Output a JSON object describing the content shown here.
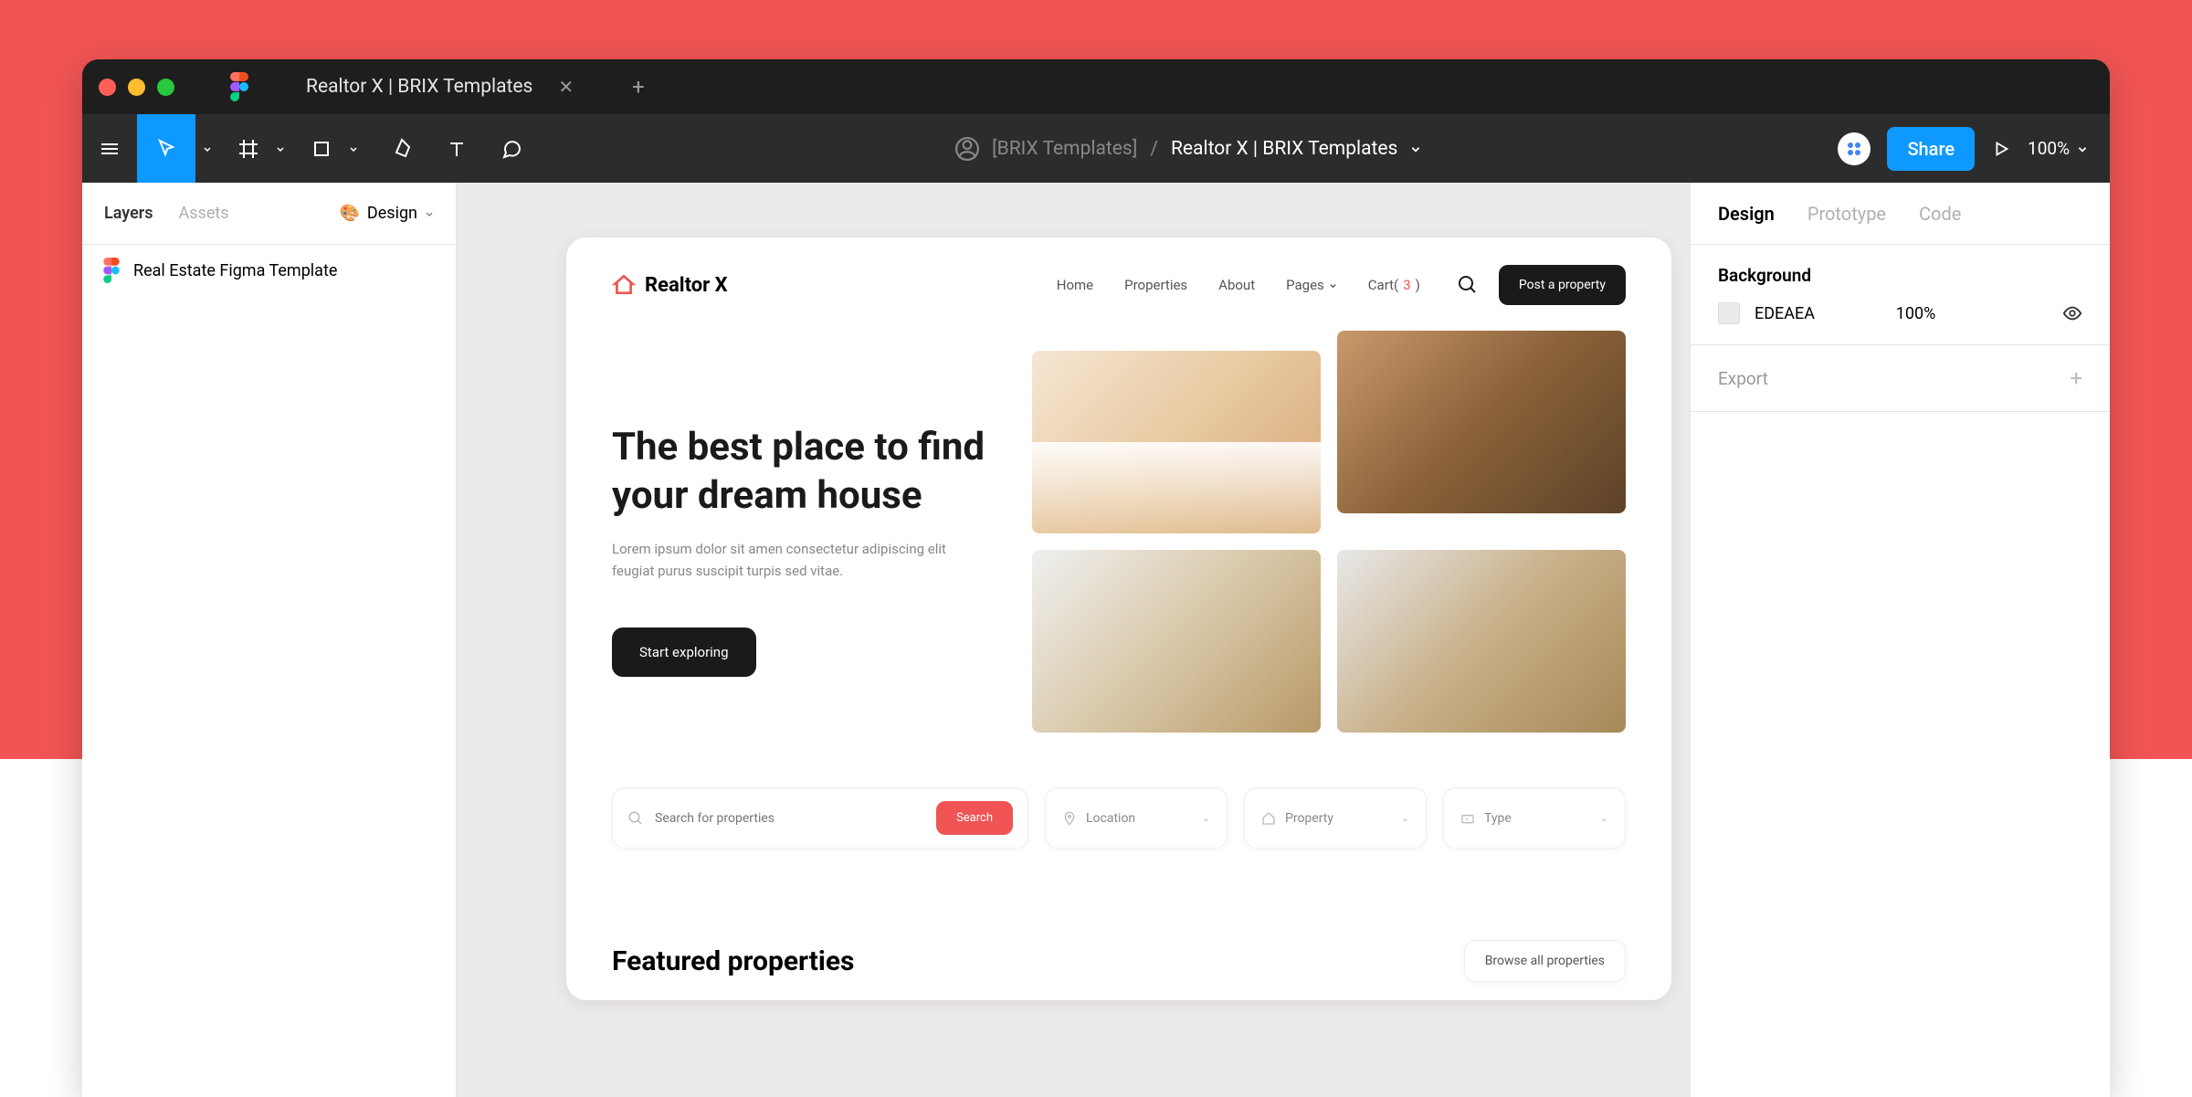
{
  "tab": {
    "title": "Realtor X | BRIX Templates"
  },
  "toolbar": {
    "owner": "[BRIX Templates]",
    "separator": "/",
    "filename": "Realtor X | BRIX Templates",
    "share_label": "Share",
    "zoom": "100%"
  },
  "left_panel": {
    "tabs": {
      "layers": "Layers",
      "assets": "Assets"
    },
    "page_selector": "Design",
    "layer": "Real Estate Figma Template"
  },
  "right_panel": {
    "tabs": {
      "design": "Design",
      "prototype": "Prototype",
      "code": "Code"
    },
    "background_title": "Background",
    "bg_hex": "EDEAEA",
    "bg_opacity": "100%",
    "export_title": "Export"
  },
  "site": {
    "brand": "Realtor X",
    "nav": {
      "home": "Home",
      "properties": "Properties",
      "about": "About",
      "pages": "Pages",
      "cart_label": "Cart(",
      "cart_count": "3",
      "cart_close": ")"
    },
    "post_btn": "Post a property",
    "hero": {
      "title": "The best place to find your dream house",
      "desc": "Lorem ipsum dolor sit amen consectetur adipiscing elit feugiat purus suscipit turpis sed vitae.",
      "explore_btn": "Start exploring"
    },
    "search": {
      "placeholder": "Search for properties",
      "search_btn": "Search",
      "location": "Location",
      "property": "Property",
      "type": "Type"
    },
    "featured": {
      "title": "Featured properties",
      "browse_btn": "Browse all properties"
    }
  }
}
